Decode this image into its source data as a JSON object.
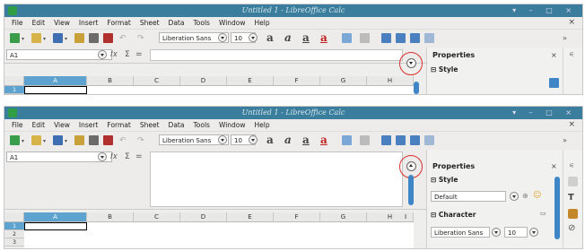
{
  "window": {
    "title": "Untitled 1 - LibreOffice Calc",
    "controls": "▾ – □ ×"
  },
  "menu": [
    "File",
    "Edit",
    "View",
    "Insert",
    "Format",
    "Sheet",
    "Data",
    "Tools",
    "Window",
    "Help"
  ],
  "menu_close": "×",
  "toolbar": {
    "font_name": "Liberation Sans",
    "font_size": "10",
    "bold": "a",
    "italic": "a",
    "underline": "a",
    "more": "»"
  },
  "formula": {
    "cell_ref": "A1",
    "fx": "𝑓𝑥",
    "sum": "Σ",
    "equals": "="
  },
  "columns": [
    "A",
    "B",
    "C",
    "D",
    "E",
    "F",
    "G",
    "H",
    "I"
  ],
  "rows": [
    "1",
    "2",
    "3"
  ],
  "sidebar": {
    "title": "Properties",
    "close": "×",
    "style_section": "Style",
    "style_value": "Default",
    "character_section": "Character",
    "font_value": "Liberation Sans",
    "size_value": "10"
  },
  "colors": {
    "titlebar": "#3a7d9c",
    "accent": "#5ea3d0",
    "highlight": "#d9302c"
  }
}
